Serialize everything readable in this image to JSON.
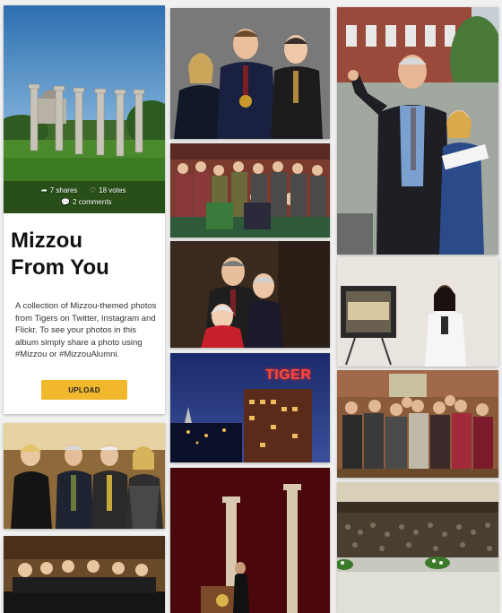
{
  "album": {
    "title_line1": "Mizzou",
    "title_line2": "From You",
    "description": "A collection of Mizzou-themed photos from Tigers on Twitter, Instagram and Flickr. To see your photos in this album simply share a photo using #Mizzou or #MizzouAlumni.",
    "upload_label": "UPLOAD",
    "shares": "7 shares",
    "votes": "18 votes",
    "comments": "2 comments"
  },
  "photos": {
    "neon_sign_text": "TIGER"
  },
  "colors": {
    "accent_gold": "#f1b82d",
    "page_background": "#f1f1f1"
  },
  "icons": {
    "shares": "share-arrow-icon",
    "votes": "heart-icon",
    "comments": "speech-bubble-icon"
  }
}
